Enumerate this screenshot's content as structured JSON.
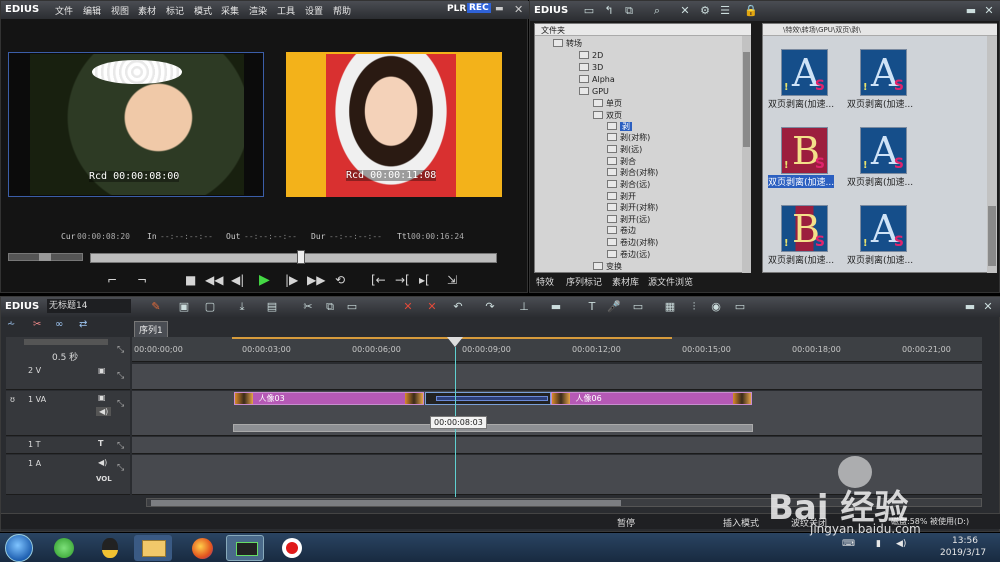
{
  "player": {
    "logo": "EDIUS",
    "menu": [
      "文件",
      "编辑",
      "视图",
      "素材",
      "标记",
      "模式",
      "采集",
      "渲染",
      "工具",
      "设置",
      "帮助"
    ],
    "plr": "PLR",
    "rec": "REC",
    "source_tc": "Rcd 00:00:08:00",
    "record_tc": "Rcd 00:00:11:08",
    "cur_label": "Cur",
    "cur": "00:00:08:20",
    "in_label": "In",
    "in": "--:--:--:--",
    "out_label": "Out",
    "out": "--:--:--:--",
    "dur_label": "Dur",
    "dur": "--:--:--:--",
    "ttl_label": "Ttl",
    "ttl": "00:00:16:24"
  },
  "bin": {
    "logo": "EDIUS",
    "folder_header": "文件夹",
    "path": "\\特效\\转场\\GPU\\双页\\剥\\",
    "tree": [
      "转场",
      "2D",
      "3D",
      "Alpha",
      "GPU",
      "单页",
      "双页",
      "剥",
      "剥(对称)",
      "剥(远)",
      "剥合",
      "剥合(对称)",
      "剥合(远)",
      "剥开",
      "剥开(对称)",
      "剥开(远)",
      "卷边",
      "卷边(对称)",
      "卷边(远)",
      "变换"
    ],
    "thumbs": [
      {
        "letter": "A",
        "caption": "双页剥离(加速..."
      },
      {
        "letter": "A",
        "caption": "双页剥离(加速..."
      },
      {
        "letter": "B",
        "caption": "双页剥离(加速..."
      },
      {
        "letter": "A",
        "caption": "双页剥离(加速..."
      },
      {
        "letter": "B",
        "caption": "双页剥离(加速..."
      },
      {
        "letter": "A",
        "caption": "双页剥离(加速..."
      }
    ],
    "tabs": [
      "特效",
      "序列标记",
      "素材库",
      "源文件浏览"
    ]
  },
  "timeline": {
    "logo": "EDIUS",
    "project": "无标题14",
    "sequence_tab": "序列1",
    "scale": "0.5 秒",
    "ruler": [
      "00:00:00;00",
      "00:00:03;00",
      "00:00:06;00",
      "00:00:09;00",
      "00:00:12;00",
      "00:00:15;00",
      "00:00:18;00",
      "00:00:21;00"
    ],
    "tracks": {
      "v2": "2 V",
      "va1": "1 VA",
      "t1": "1 T",
      "a1": "1 A",
      "vol": "VOL"
    },
    "clip1": "人像03",
    "clip2": "人像06",
    "tooltip": "00:00:08:03",
    "status": {
      "pause": "暂停",
      "insert": "插入模式",
      "ripple": "波纹关闭",
      "disk": "磁盘:58% 被使用(D:)"
    }
  },
  "taskbar": {
    "time": "13:56",
    "date": "2019/3/17",
    "watermark": "Bai 经验",
    "watermark_url": "jingyan.baidu.com"
  },
  "colors": {
    "accent_blue": "#4a7ed8",
    "clip_purple": "#b559b5",
    "rec_blue": "#2f62d7",
    "play_green": "#44d844"
  }
}
